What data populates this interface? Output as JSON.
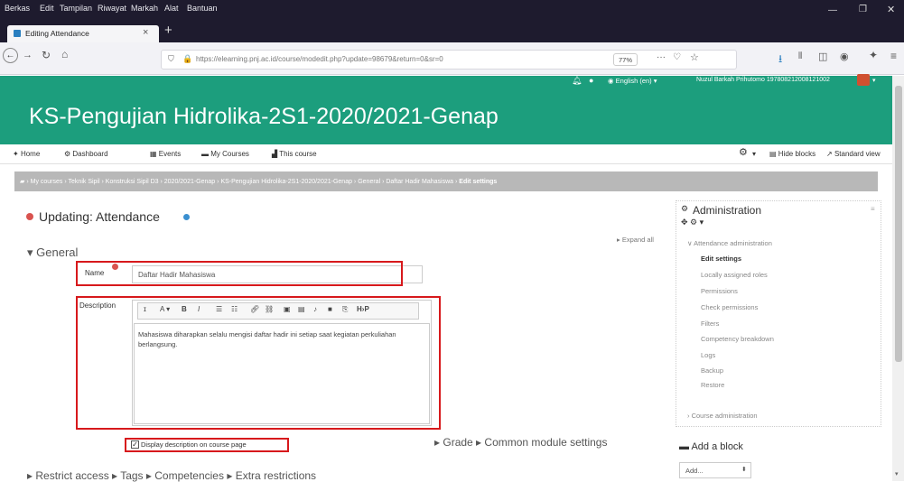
{
  "menubar": {
    "items": [
      "Berkas",
      "Edit",
      "Tampilan",
      "Riwayat",
      "Markah",
      "Alat",
      "Bantuan"
    ]
  },
  "tab": {
    "title": "Editing Attendance"
  },
  "url": {
    "text": "https://elearning.pnj.ac.id/course/modedit.php?update=98679&return=0&sr=0",
    "zoom": "77%"
  },
  "topbar": {
    "language": "English (en)",
    "user": "Nuzul Barkah Prihutomo 197808212008121002"
  },
  "course": {
    "title": "KS-Pengujian Hidrolika-2S1-2020/2021-Genap"
  },
  "coursenav": {
    "home": "Home",
    "dashboard": "Dashboard",
    "events": "Events",
    "mycourses": "My Courses",
    "thiscourse": "This course",
    "hideblocks": "Hide blocks",
    "standardview": "Standard view"
  },
  "breadcrumb": [
    "My courses",
    "Teknik Sipil",
    "Konstruksi Sipil D3",
    "2020/2021-Genap",
    "KS-Pengujian Hidrolika-2S1-2020/2021-Genap",
    "General",
    "Daftar Hadir Mahasiswa",
    "Edit settings"
  ],
  "page": {
    "heading": "Updating: Attendance",
    "expand_all": "Expand all",
    "section": "General"
  },
  "form": {
    "name_label": "Name",
    "name_value": "Daftar Hadir Mahasiswa",
    "description_label": "Description",
    "description_text": "Mahasiswa diharapkan selalu mengisi daftar hadir ini setiap saat kegiatan perkuliahan berlangsung.",
    "display_checkbox_label": "Display description on course page",
    "display_checked": true
  },
  "sections": {
    "grade": "Grade",
    "common": "Common module settings",
    "restrict": "Restrict access",
    "tags": "Tags",
    "competencies": "Competencies",
    "extra": "Extra restrictions"
  },
  "admin": {
    "title": "Administration",
    "group": "Attendance administration",
    "items": [
      "Edit settings",
      "Locally assigned roles",
      "Permissions",
      "Check permissions",
      "Filters",
      "Competency breakdown",
      "Logs",
      "Backup",
      "Restore"
    ],
    "course_admin": "Course administration"
  },
  "addblock": {
    "title": "Add a block",
    "select": "Add..."
  },
  "colors": {
    "teal": "#1c9e7d",
    "breadcrumb_bg": "#b8b8b8",
    "annotation_red": "#d7191c",
    "browser_dark": "#1e1b2e"
  }
}
